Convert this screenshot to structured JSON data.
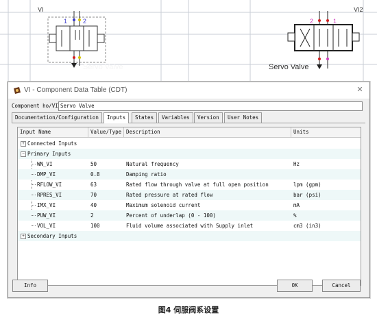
{
  "schematic": {
    "left_id": "VI",
    "right_id": "VI2",
    "left_label": "Servo Valve",
    "right_label": "Servo Valve",
    "left_ports": [
      "1",
      "2"
    ],
    "right_ports": [
      "2",
      "1"
    ],
    "colors": {
      "port_blue": "#3a3acc",
      "port_yellow": "#d6c400",
      "port_red": "#d01f1f",
      "port_magenta": "#d23fbf",
      "grid": "#c9ced6"
    }
  },
  "dialog": {
    "title": "VI - Component Data Table (CDT)",
    "component_label": "Component ho/VI",
    "component_value": "Servo Valve",
    "tabs": [
      "Documentation/Configuration",
      "Inputs",
      "States",
      "Variables",
      "Version",
      "User Notes"
    ],
    "active_tab": "Inputs",
    "columns": [
      "Input Name",
      "Value/Type",
      "Description",
      "Units"
    ],
    "groups": [
      {
        "label": "Connected Inputs",
        "expanded": false
      },
      {
        "label": "Primary Inputs",
        "expanded": true
      },
      {
        "label": "Secondary Inputs",
        "expanded": false
      }
    ],
    "rows": [
      {
        "name": "WN_VI",
        "value": "50",
        "description": "Natural frequency",
        "units": "Hz"
      },
      {
        "name": "DMP_VI",
        "value": "0.8",
        "description": "Damping ratio",
        "units": ""
      },
      {
        "name": "RFLOW_VI",
        "value": "63",
        "description": "Rated flow through valve at full open position",
        "units": "lpm (gpm)"
      },
      {
        "name": "RPRES_VI",
        "value": "70",
        "description": "Rated pressure at rated flow",
        "units": "bar (psi)"
      },
      {
        "name": "IMX_VI",
        "value": "40",
        "description": "Maximum solenoid current",
        "units": "mA"
      },
      {
        "name": "PUW_VI",
        "value": "2",
        "description": "Percent of underlap (0 - 100)",
        "units": "%"
      },
      {
        "name": "VOL_VI",
        "value": "100",
        "description": "Fluid volume associated with Supply inlet",
        "units": "cm3 (in3)"
      }
    ],
    "buttons": {
      "info": "Info",
      "ok": "OK",
      "cancel": "Cancel"
    }
  },
  "caption": "图4 伺服阀系设置"
}
